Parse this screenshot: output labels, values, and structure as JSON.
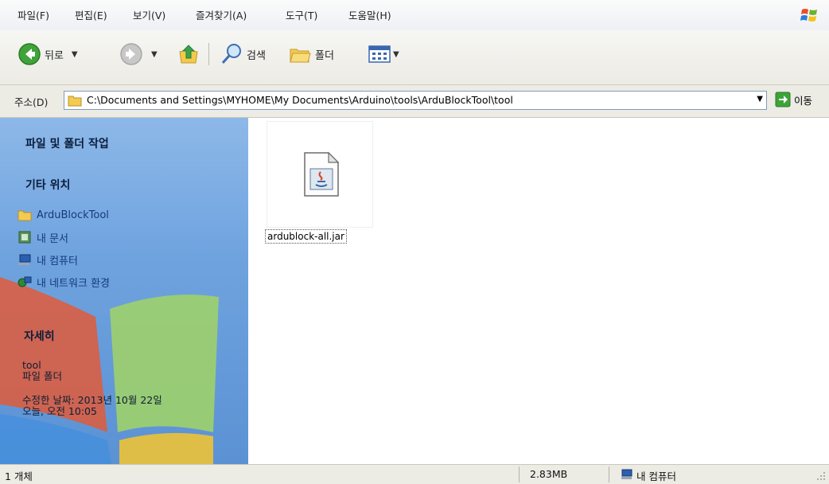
{
  "menubar": {
    "items": [
      "파일(F)",
      "편집(E)",
      "보기(V)",
      "즐겨찾기(A)",
      "도구(T)",
      "도움말(H)"
    ]
  },
  "toolbar": {
    "back_label": "뒤로",
    "search_label": "검색",
    "folders_label": "폴더"
  },
  "address": {
    "label": "주소(D)",
    "path": "C:\\Documents and Settings\\MYHOME\\My Documents\\Arduino\\tools\\ArduBlockTool\\tool",
    "go_label": "이동"
  },
  "taskpane": {
    "file_tasks_title": "파일 및 폴더 작업",
    "other_places_title": "기타 위치",
    "other_places": [
      "ArduBlockTool",
      "내 문서",
      "내 컴퓨터",
      "내 네트워크 환경"
    ],
    "details_title": "자세히",
    "details": {
      "name": "tool",
      "type": "파일 폴더",
      "modified": "수정한 날짜: 2013년 10월 22일",
      "time": "오늘, 오전 10:05"
    }
  },
  "content": {
    "files": [
      {
        "name": "ardublock-all.jar",
        "icon": "java-jar-icon"
      }
    ]
  },
  "status": {
    "objects": "1 개체",
    "size": "2.83MB",
    "location": "내 컴퓨터"
  }
}
